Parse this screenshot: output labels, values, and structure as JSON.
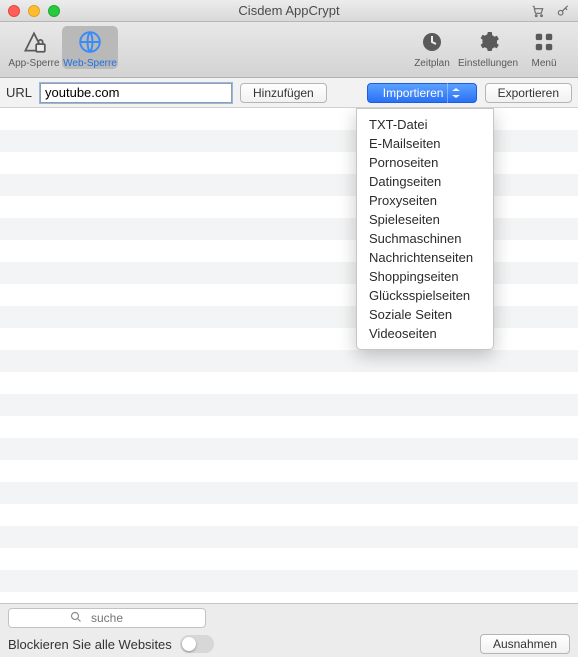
{
  "window": {
    "title": "Cisdem AppCrypt"
  },
  "toolbar": {
    "app_lock": {
      "label": "App-Sperre"
    },
    "web_lock": {
      "label": "Web-Sperre"
    },
    "schedule": {
      "label": "Zeitplan"
    },
    "settings": {
      "label": "Einstellungen"
    },
    "menu": {
      "label": "Menü"
    }
  },
  "urlrow": {
    "label": "URL",
    "value": "youtube.com",
    "add": "Hinzufügen",
    "import": "Importieren",
    "export": "Exportieren"
  },
  "import_menu": [
    "TXT-Datei",
    "E-Mailseiten",
    "Pornoseiten",
    "Datingseiten",
    "Proxyseiten",
    "Spieleseiten",
    "Suchmaschinen",
    "Nachrichtenseiten",
    "Shoppingseiten",
    "Glücksspielseiten",
    "Soziale Seiten",
    "Videoseiten"
  ],
  "footer": {
    "search_placeholder": "suche",
    "block_all": "Blockieren Sie alle Websites",
    "exceptions": "Ausnahmen"
  }
}
